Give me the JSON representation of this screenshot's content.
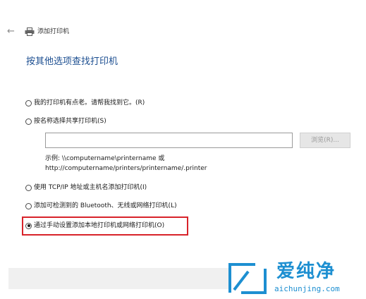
{
  "window": {
    "back_icon": "back-arrow-icon",
    "printer_icon": "printer-icon",
    "title": "添加打印机"
  },
  "heading": "按其他选项查找打印机",
  "options": [
    {
      "label": "我的打印机有点老。请帮我找到它。(R)",
      "checked": false
    },
    {
      "label": "按名称选择共享打印机(S)",
      "checked": false
    },
    {
      "label": "使用 TCP/IP 地址或主机名添加打印机(I)",
      "checked": false
    },
    {
      "label": "添加可检测到的 Bluetooth、无线或网络打印机(L)",
      "checked": false
    },
    {
      "label": "通过手动设置添加本地打印机或网络打印机(O)",
      "checked": true
    }
  ],
  "share_input": {
    "value": "",
    "placeholder": ""
  },
  "browse_label": "浏览(R)...",
  "example_line1": "示例: \\\\computername\\printername 或",
  "example_line2": "http://computername/printers/printername/.printer",
  "watermark": {
    "brand": "爱纯净",
    "domain": "aichunjing.com",
    "color": "#1d8fd1"
  },
  "highlight_color": "#d8232a"
}
